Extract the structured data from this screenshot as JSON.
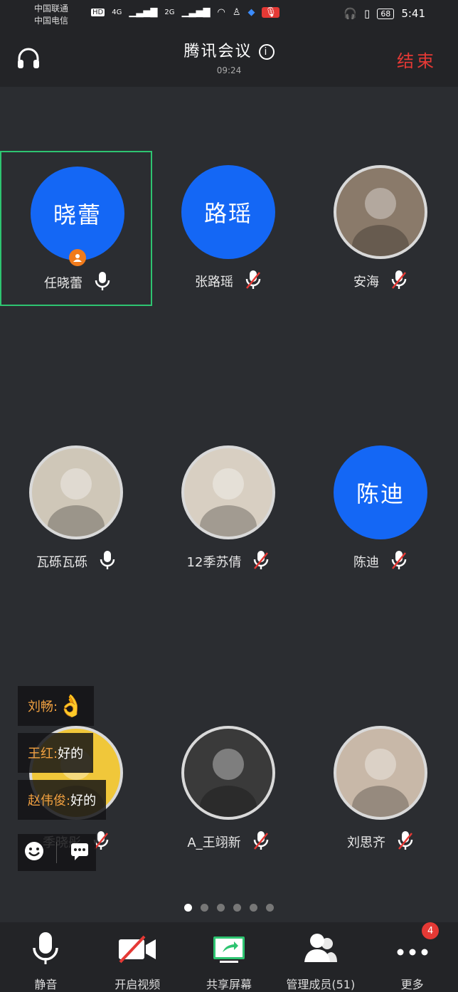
{
  "status_bar": {
    "carrier1": "中国联通",
    "carrier2": "中国电信",
    "hd": "HD",
    "net1": "4G",
    "net2": "2G",
    "battery": "68",
    "time": "5:41"
  },
  "header": {
    "title": "腾讯会议",
    "elapsed": "09:24",
    "end_label": "结束"
  },
  "participants": [
    {
      "display": "晓蕾",
      "name": "任晓蕾",
      "muted": false,
      "avatar": "blue",
      "host": true
    },
    {
      "display": "路瑶",
      "name": "张路瑶",
      "muted": true,
      "avatar": "blue"
    },
    {
      "display": "",
      "name": "安海",
      "muted": true,
      "avatar": "photo-rabbit-ears"
    },
    {
      "display": "",
      "name": "瓦砾瓦砾",
      "muted": false,
      "avatar": "photo-cartoon"
    },
    {
      "display": "",
      "name": "12季苏倩",
      "muted": true,
      "avatar": "photo-child"
    },
    {
      "display": "陈迪",
      "name": "陈迪",
      "muted": true,
      "avatar": "blue"
    },
    {
      "display": "",
      "name": "季晓彤",
      "muted": true,
      "avatar": "photo-emoji"
    },
    {
      "display": "",
      "name": "A_王翊新",
      "muted": true,
      "avatar": "photo-camera"
    },
    {
      "display": "",
      "name": "刘思齐",
      "muted": true,
      "avatar": "photo-girl"
    }
  ],
  "chat_messages": [
    {
      "who": "刘畅:",
      "text": "👌"
    },
    {
      "who": "王红:",
      "text": "好的"
    },
    {
      "who": "赵伟俊:",
      "text": "好的"
    }
  ],
  "pager": {
    "pages": 6,
    "current": 1
  },
  "toolbar": {
    "mute": "静音",
    "video": "开启视频",
    "share": "共享屏幕",
    "members": "管理成员(51)",
    "more": "更多",
    "more_badge": "4"
  },
  "colors": {
    "accent_blue": "#1467f5",
    "end_red": "#e53935",
    "active_border": "#2ec471",
    "share_green": "#2ec471"
  }
}
